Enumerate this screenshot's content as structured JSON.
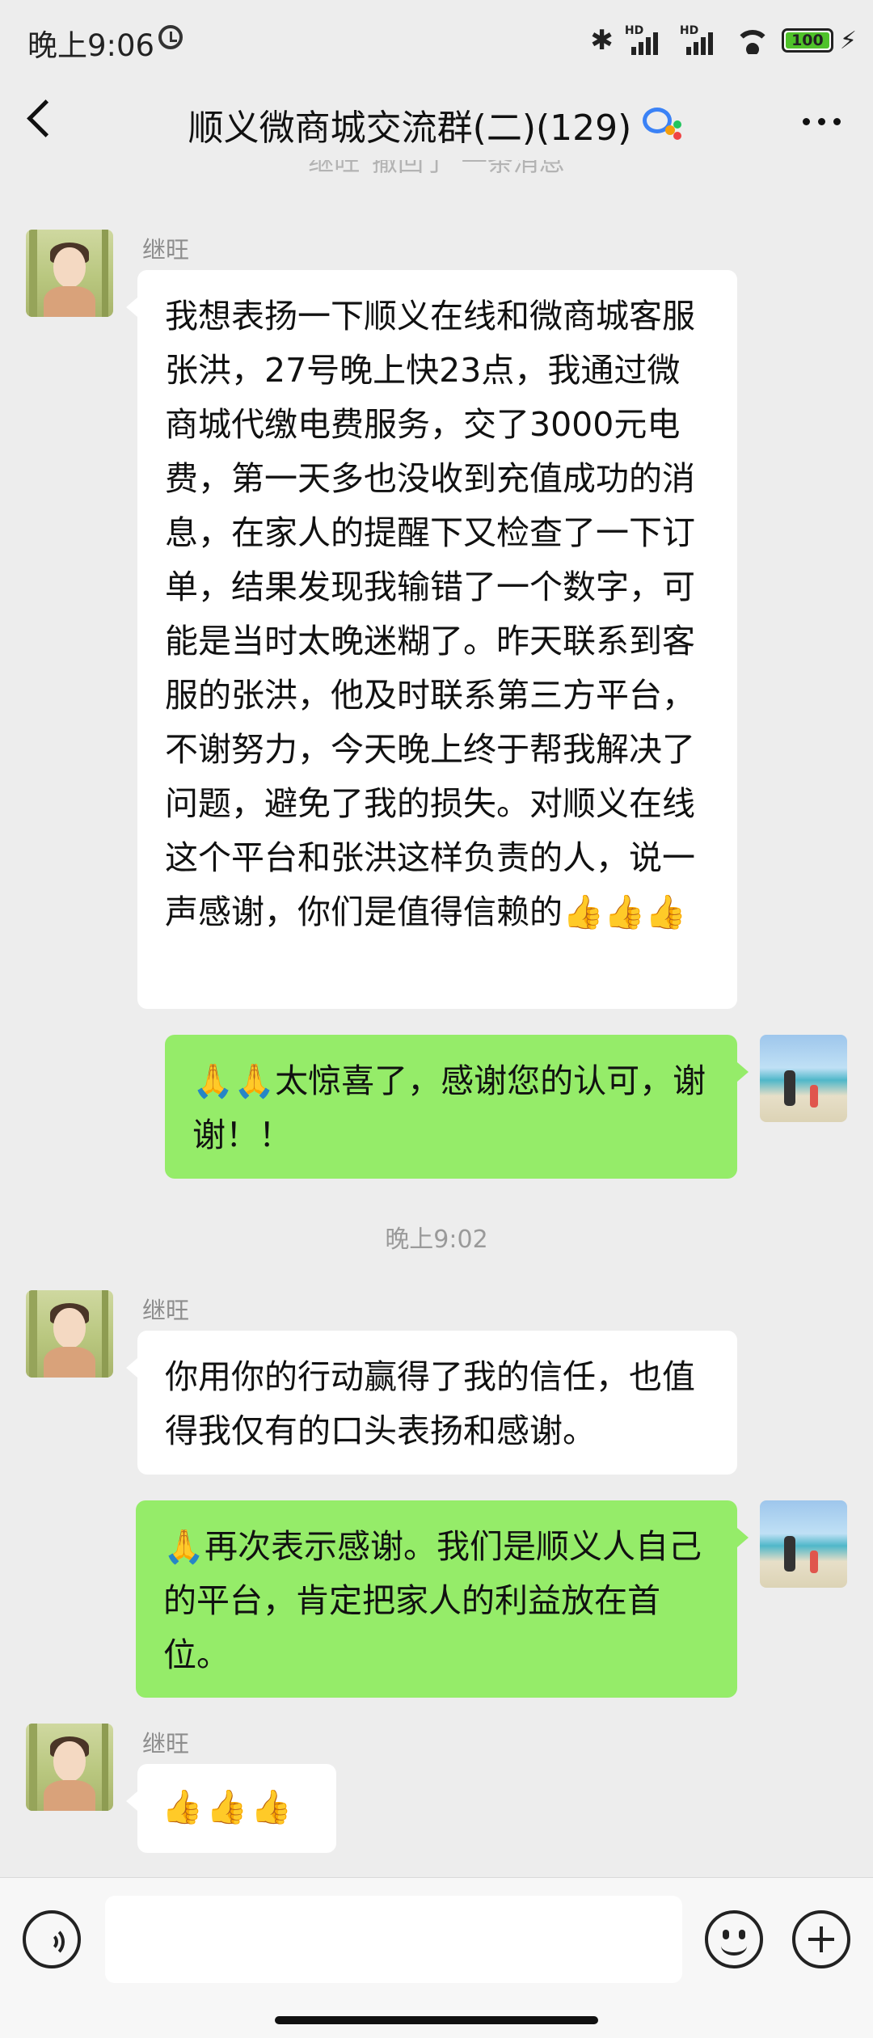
{
  "status_bar": {
    "time": "晚上9:06",
    "signal_label_1": "HD",
    "signal_label_2": "HD",
    "battery": "100",
    "bluetooth_icon": "bluetooth-icon",
    "bolt_icon": "charging-bolt-icon"
  },
  "header": {
    "title": "顺义微商城交流群(二)(129)",
    "back_icon": "chevron-left-icon",
    "more_icon": "more-dots-icon",
    "group_icon": "chat-bubble-icon"
  },
  "partial_system_notice": "继旺\"撤回了\"一条消息",
  "messages": [
    {
      "direction": "in",
      "sender": "继旺",
      "text": "我想表扬一下顺义在线和微商城客服张洪，27号晚上快23点，我通过微商城代缴电费服务，交了3000元电费，第一天多也没收到充值成功的消息，在家人的提醒下又检查了一下订单，结果发现我输错了一个数字，可能是当时太晚迷糊了。昨天联系到客服的张洪，他及时联系第三方平台，不谢努力，今天晚上终于帮我解决了问题，避免了我的损失。对顺义在线这个平台和张洪这样负责的人，说一声感谢，你们是值得信赖的👍👍👍"
    },
    {
      "direction": "out",
      "text": "🙏🙏太惊喜了，感谢您的认可，谢谢！！"
    },
    {
      "direction": "in",
      "sender": "继旺",
      "text": "你用你的行动赢得了我的信任，也值得我仅有的口头表扬和感谢。"
    },
    {
      "direction": "out",
      "text": "🙏再次表示感谢。我们是顺义人自己的平台，肯定把家人的利益放在首位。"
    },
    {
      "direction": "in",
      "sender": "继旺",
      "text": "👍👍👍"
    }
  ],
  "timestamp": "晚上9:02",
  "input_bar": {
    "value": "",
    "voice_icon": "voice-icon",
    "emoji_icon": "emoji-smile-icon",
    "plus_icon": "plus-circle-icon"
  },
  "colors": {
    "background": "#ededed",
    "outgoing_bubble": "#95ec69",
    "incoming_bubble": "#ffffff"
  }
}
